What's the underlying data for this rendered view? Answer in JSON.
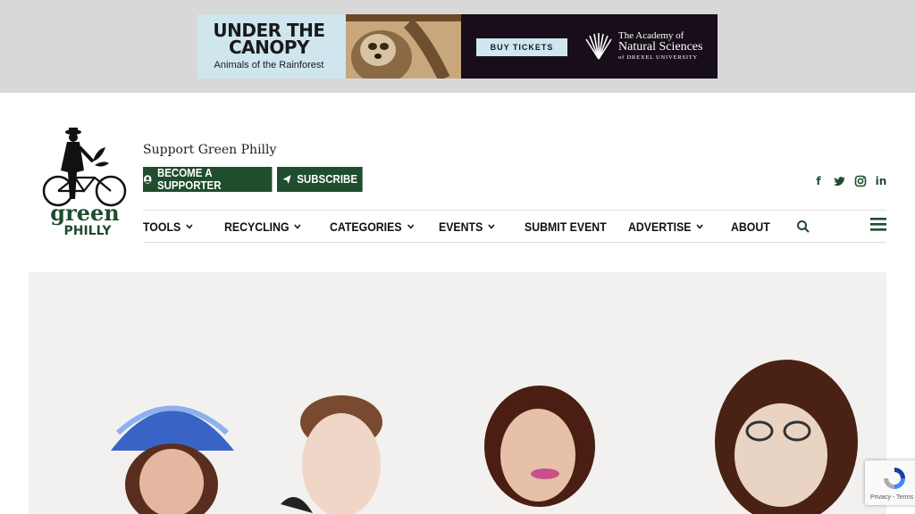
{
  "ad": {
    "title_line1": "UNDER THE",
    "title_line2": "CANOPY",
    "subtitle": "Animals of the Rainforest",
    "button": "BUY TICKETS",
    "org_line1": "The Academy of",
    "org_line2": "Natural Sciences",
    "org_line3": "of DREXEL UNIVERSITY"
  },
  "header": {
    "logo_text": "green PHILLY",
    "support_label": "Support Green Philly",
    "btn_supporter": "BECOME A SUPPORTER",
    "btn_subscribe": "SUBSCRIBE"
  },
  "social": {
    "facebook": "f",
    "twitter": "🐦",
    "instagram": "◎",
    "linkedin": "in"
  },
  "nav": {
    "items": [
      {
        "label": "TOOLS",
        "dropdown": true
      },
      {
        "label": "RECYCLING",
        "dropdown": true
      },
      {
        "label": "CATEGORIES",
        "dropdown": true
      },
      {
        "label": "EVENTS",
        "dropdown": true
      },
      {
        "label": "SUBMIT EVENT",
        "dropdown": false
      },
      {
        "label": "ADVERTISE",
        "dropdown": true
      },
      {
        "label": "ABOUT",
        "dropdown": false
      }
    ]
  },
  "recaptcha": {
    "text": "Privacy - Terms"
  },
  "colors": {
    "brand_green": "#1f4d2e",
    "ad_dark": "#180e1a",
    "ad_light": "#cfe6ee"
  }
}
